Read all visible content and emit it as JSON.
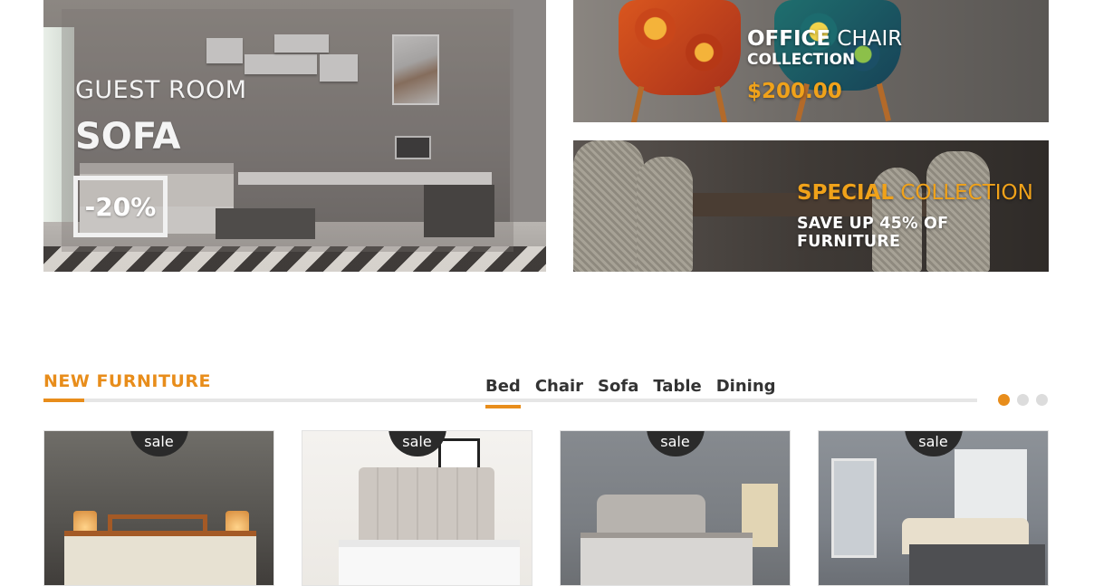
{
  "banners": {
    "guest_room": {
      "subtitle": "GUEST ROOM",
      "title": "SOFA",
      "discount": "-20%"
    },
    "office_chair": {
      "title_bold": "OFFICE",
      "title_rest": " CHAIR",
      "subtitle": "COLLECTION",
      "price": "$200.00"
    },
    "special": {
      "title_bold": "SPECIAL",
      "title_rest": " COLLECTION",
      "subtitle": "SAVE UP 45% OF FURNITURE"
    }
  },
  "new_furniture": {
    "title": "NEW FURNITURE",
    "tabs": [
      {
        "label": "Bed",
        "active": true
      },
      {
        "label": "Chair",
        "active": false
      },
      {
        "label": "Sofa",
        "active": false
      },
      {
        "label": "Table",
        "active": false
      },
      {
        "label": "Dining",
        "active": false
      }
    ],
    "carousel_pages": 3,
    "active_page": 1,
    "products": [
      {
        "badge": "sale"
      },
      {
        "badge": "sale"
      },
      {
        "badge": "sale"
      },
      {
        "badge": "sale"
      }
    ]
  },
  "colors": {
    "accent": "#e88d1b",
    "text_dark": "#333333",
    "rule": "#e6e6e6",
    "badge": "#2a2a2a"
  }
}
